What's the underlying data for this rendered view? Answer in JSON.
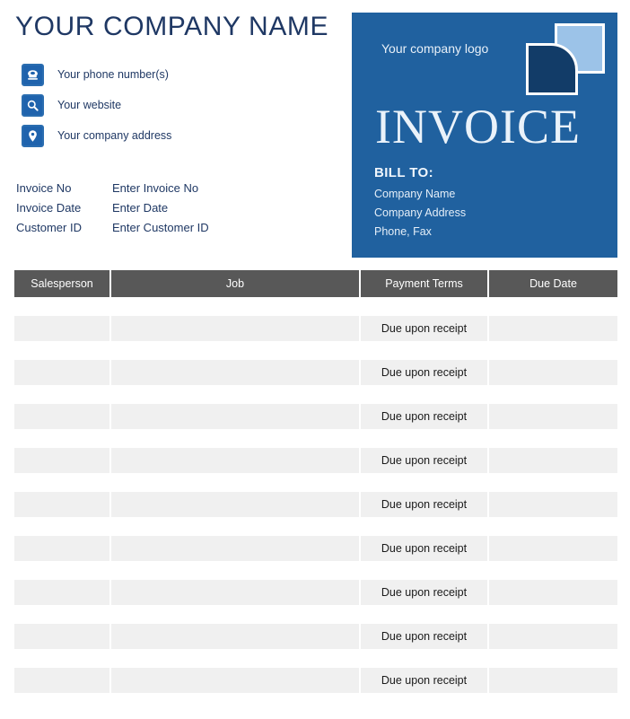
{
  "header": {
    "company_title": "YOUR COMPANY NAME",
    "contacts": [
      {
        "icon": "telephone-icon",
        "label": "Your phone number(s)"
      },
      {
        "icon": "magnifier-icon",
        "label": "Your website"
      },
      {
        "icon": "location-pin-icon",
        "label": "Your company address"
      }
    ]
  },
  "invoice_meta": [
    {
      "label": "Invoice No",
      "value": "Enter Invoice No"
    },
    {
      "label": "Invoice Date",
      "value": "Enter Date"
    },
    {
      "label": "Customer ID",
      "value": "Enter Customer ID"
    }
  ],
  "panel": {
    "logo_caption": "Your company logo",
    "title": "INVOICE",
    "bill_to_heading": "BILL TO:",
    "bill_to_lines": [
      "Company Name",
      "Company Address",
      "Phone, Fax"
    ]
  },
  "table": {
    "columns": [
      "Salesperson",
      "Job",
      "Payment Terms",
      "Due Date"
    ],
    "rows": [
      {
        "salesperson": "",
        "job": "",
        "payment_terms": "Due upon receipt",
        "due_date": ""
      },
      {
        "salesperson": "",
        "job": "",
        "payment_terms": "Due upon receipt",
        "due_date": ""
      },
      {
        "salesperson": "",
        "job": "",
        "payment_terms": "Due upon receipt",
        "due_date": ""
      },
      {
        "salesperson": "",
        "job": "",
        "payment_terms": "Due upon receipt",
        "due_date": ""
      },
      {
        "salesperson": "",
        "job": "",
        "payment_terms": "Due upon receipt",
        "due_date": ""
      },
      {
        "salesperson": "",
        "job": "",
        "payment_terms": "Due upon receipt",
        "due_date": ""
      },
      {
        "salesperson": "",
        "job": "",
        "payment_terms": "Due upon receipt",
        "due_date": ""
      },
      {
        "salesperson": "",
        "job": "",
        "payment_terms": "Due upon receipt",
        "due_date": ""
      },
      {
        "salesperson": "",
        "job": "",
        "payment_terms": "Due upon receipt",
        "due_date": ""
      }
    ]
  },
  "colors": {
    "brand_blue": "#20619f",
    "logo_dark": "#123c68",
    "logo_light": "#9cc3e8",
    "title_navy": "#1f3864",
    "table_header_gray": "#585858",
    "row_gray": "#f0f0f0"
  }
}
